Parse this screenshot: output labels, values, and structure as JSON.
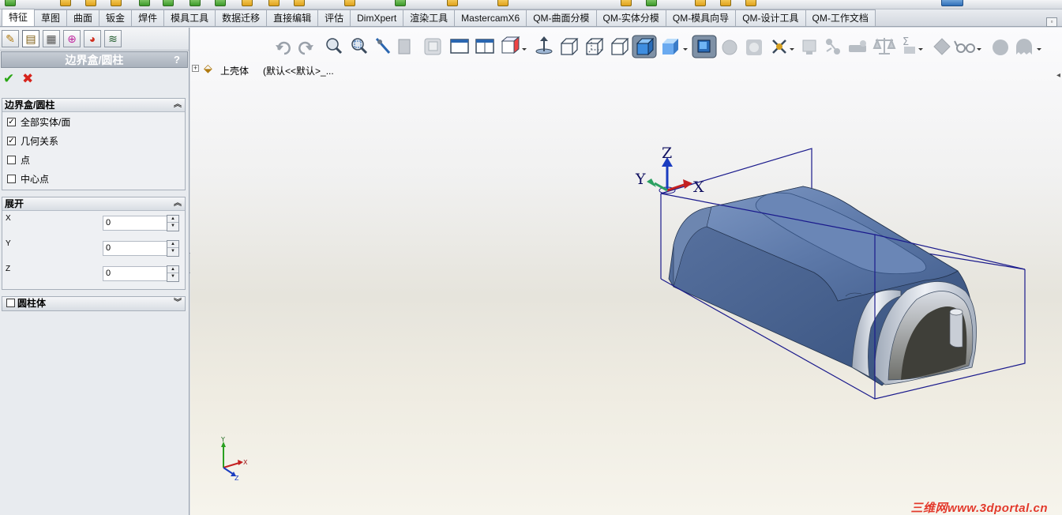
{
  "tabs": [
    "特征",
    "草图",
    "曲面",
    "钣金",
    "焊件",
    "模具工具",
    "数据迁移",
    "直接编辑",
    "评估",
    "DimXpert",
    "渲染工具",
    "MastercamX6",
    "QM-曲面分模",
    "QM-实体分模",
    "QM-模具向导",
    "QM-设计工具",
    "QM-工作文档"
  ],
  "active_tab": "特征",
  "panel": {
    "title": "边界盒/圆柱",
    "help_label": "?",
    "ok_icon": "✔",
    "cancel_icon": "✖",
    "group_bbox": {
      "title": "边界盒/圆柱",
      "options": [
        {
          "label": "全部实体/面",
          "checked": true
        },
        {
          "label": "几何关系",
          "checked": true
        },
        {
          "label": "点",
          "checked": false
        },
        {
          "label": "中心点",
          "checked": false
        }
      ]
    },
    "group_expand": {
      "title": "展开",
      "fields": [
        {
          "label": "X",
          "value": "0"
        },
        {
          "label": "Y",
          "value": "0"
        },
        {
          "label": "Z",
          "value": "0"
        }
      ]
    },
    "group_cylinder": {
      "title": "圆柱体",
      "checked": false
    }
  },
  "tree": {
    "part_name": "上壳体",
    "config": "(默认<<默认>_..."
  },
  "triad": {
    "x": "X",
    "y": "Y",
    "z": "Z"
  },
  "watermark": "三维网www.3dportal.cn",
  "colors": {
    "model": "#4a6897",
    "bbox": "#1a1a8c",
    "accent_ok": "#2aa614",
    "accent_cancel": "#d6241c"
  }
}
